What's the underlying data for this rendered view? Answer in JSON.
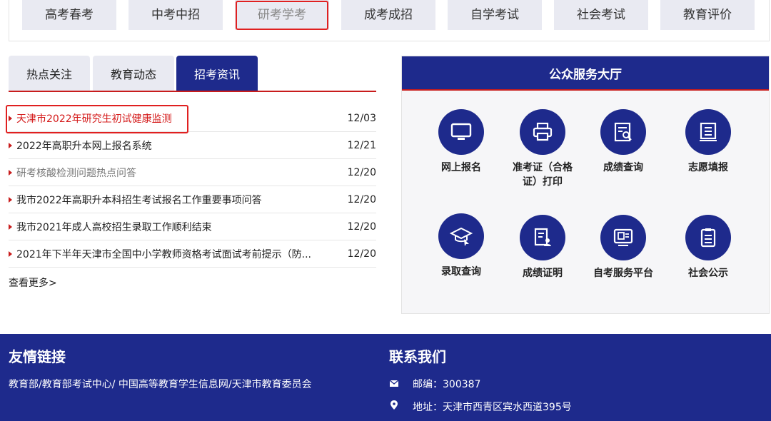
{
  "topnav": [
    "高考春考",
    "中考中招",
    "研考学考",
    "成考成招",
    "自学考试",
    "社会考试",
    "教育评价"
  ],
  "news_tabs": [
    "热点关注",
    "教育动态",
    "招考资讯"
  ],
  "news": [
    {
      "title": "天津市2022年研究生初试健康监测",
      "date": "12/03"
    },
    {
      "title": "2022年高职升本网上报名系统",
      "date": "12/21"
    },
    {
      "title": "研考核酸检测问题热点问答",
      "date": "12/20"
    },
    {
      "title": "我市2022年高职升本科招生考试报名工作重要事项问答",
      "date": "12/20"
    },
    {
      "title": "我市2021年成人高校招生录取工作顺利结束",
      "date": "12/20"
    },
    {
      "title": "2021年下半年天津市全国中小学教师资格考试面试考前提示（防...",
      "date": "12/20"
    }
  ],
  "more": "查看更多>",
  "hall": {
    "title": "公众服务大厅",
    "services": [
      {
        "label": "网上报名",
        "icon": "monitor-icon"
      },
      {
        "label": "准考证（合格证）打印",
        "icon": "printer-icon"
      },
      {
        "label": "成绩查询",
        "icon": "score-search-icon"
      },
      {
        "label": "志愿填报",
        "icon": "form-list-icon"
      },
      {
        "label": "录取查询",
        "icon": "graduation-cap-icon"
      },
      {
        "label": "成绩证明",
        "icon": "certificate-icon"
      },
      {
        "label": "自考服务平台",
        "icon": "platform-icon"
      },
      {
        "label": "社会公示",
        "icon": "clipboard-icon"
      }
    ]
  },
  "footer": {
    "links_title": "友情链接",
    "links_text": "教育部/教育部考试中心/ 中国高等教育学生信息网/天津市教育委员会",
    "contact_title": "联系我们",
    "postcode": "邮编：300387",
    "address": "地址：天津市西青区宾水西道395号"
  },
  "colors": {
    "brand": "#1e2a8c",
    "accent": "#c81c1c",
    "tab_bg": "#e9eaf2"
  }
}
